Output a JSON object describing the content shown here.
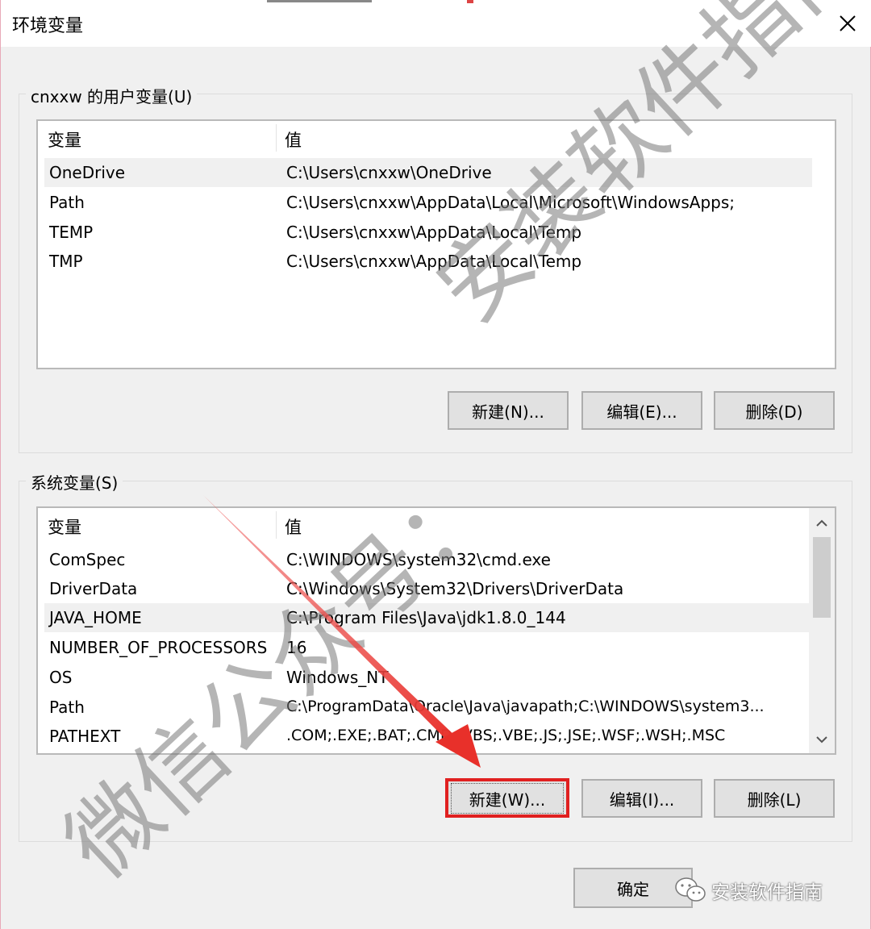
{
  "window": {
    "title": "环境变量"
  },
  "user_group": {
    "legend": "cnxxw 的用户变量(U)",
    "headers": {
      "name": "变量",
      "value": "值"
    },
    "rows": [
      {
        "name": "OneDrive",
        "value": "C:\\Users\\cnxxw\\OneDrive"
      },
      {
        "name": "Path",
        "value": "C:\\Users\\cnxxw\\AppData\\Local\\Microsoft\\WindowsApps;"
      },
      {
        "name": "TEMP",
        "value": "C:\\Users\\cnxxw\\AppData\\Local\\Temp"
      },
      {
        "name": "TMP",
        "value": "C:\\Users\\cnxxw\\AppData\\Local\\Temp"
      }
    ],
    "buttons": {
      "new": "新建(N)...",
      "edit": "编辑(E)...",
      "delete": "删除(D)"
    }
  },
  "system_group": {
    "legend": "系统变量(S)",
    "headers": {
      "name": "变量",
      "value": "值"
    },
    "rows": [
      {
        "name": "ComSpec",
        "value": "C:\\WINDOWS\\system32\\cmd.exe"
      },
      {
        "name": "DriverData",
        "value": "C:\\Windows\\System32\\Drivers\\DriverData"
      },
      {
        "name": "JAVA_HOME",
        "value": "C:\\Program Files\\Java\\jdk1.8.0_144"
      },
      {
        "name": "NUMBER_OF_PROCESSORS",
        "value": "16"
      },
      {
        "name": "OS",
        "value": "Windows_NT"
      },
      {
        "name": "Path",
        "value": "C:\\ProgramData\\Oracle\\Java\\javapath;C:\\WINDOWS\\system3..."
      },
      {
        "name": "PATHEXT",
        "value": ".COM;.EXE;.BAT;.CMD;.VBS;.VBE;.JS;.JSE;.WSF;.WSH;.MSC"
      }
    ],
    "buttons": {
      "new": "新建(W)...",
      "edit": "编辑(I)...",
      "delete": "删除(L)"
    }
  },
  "footer": {
    "ok": "确定",
    "badge": "安装软件指南"
  },
  "watermarks": {
    "top": "安装软件指南",
    "bottom": "微信公众号："
  },
  "colors": {
    "highlight": "#e02020",
    "accent_arrow": "#e8302a"
  }
}
